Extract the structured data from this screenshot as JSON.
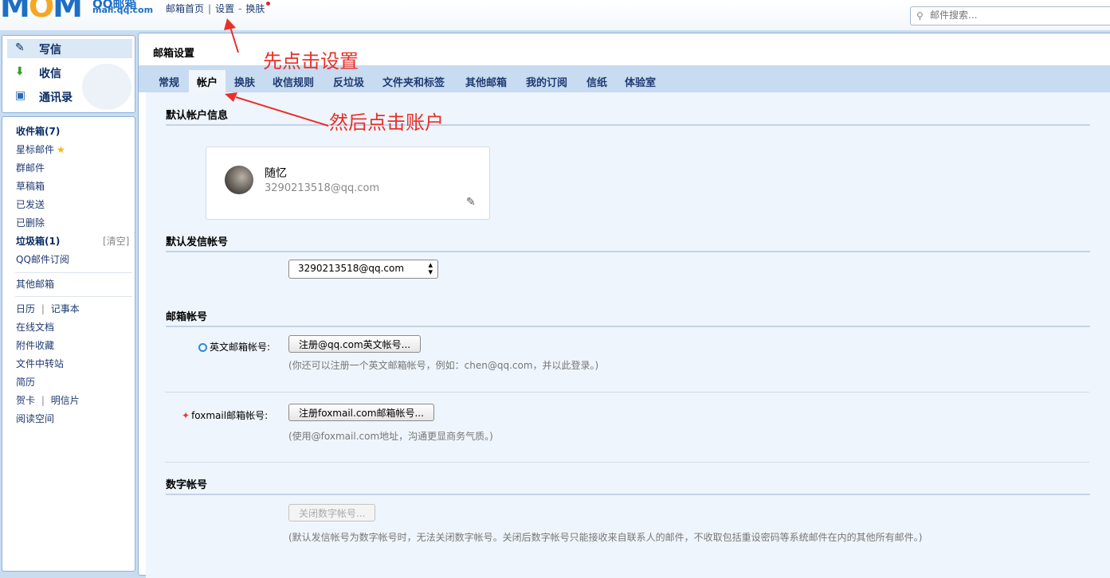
{
  "header": {
    "logo_mark": "M",
    "logo_mark_o": "O",
    "logo_mark_m2": "M",
    "logo_text": "QQ邮箱",
    "logo_url": "mail.qq.com",
    "links": [
      "邮箱首页",
      "设置",
      "换肤"
    ],
    "link_seps": [
      "|",
      "-"
    ],
    "search_placeholder": "邮件搜索...",
    "search_icon": "search-icon"
  },
  "sidebar": {
    "top_items": [
      {
        "label": "写信",
        "icon": "pen-paper-icon"
      },
      {
        "label": "收信",
        "icon": "download-tray-icon"
      },
      {
        "label": "通讯录",
        "icon": "contact-card-icon"
      }
    ],
    "folders": {
      "inbox": "收件箱(7)",
      "starred": "星标邮件",
      "group": "群邮件",
      "drafts": "草稿箱",
      "sent": "已发送",
      "deleted": "已删除",
      "spam": "垃圾箱(1)",
      "spam_clear": "[清空]",
      "subscriptions": "QQ邮件订阅",
      "other_mailboxes": "其他邮箱",
      "calendar": "日历",
      "notes": "记事本",
      "online_docs": "在线文档",
      "attachments": "附件收藏",
      "file_transfer": "文件中转站",
      "resume": "简历",
      "greeting_card": "贺卡",
      "postcard": "明信片",
      "reading_space": "阅读空间",
      "sep": "|"
    }
  },
  "main": {
    "title": "邮箱设置",
    "tabs": [
      "常规",
      "帐户",
      "换肤",
      "收信规则",
      "反垃圾",
      "文件夹和标签",
      "其他邮箱",
      "我的订阅",
      "信纸",
      "体验室"
    ],
    "active_tab": "帐户",
    "sections": {
      "default_account_info": "默认帐户信息",
      "default_sender": "默认发信帐号",
      "mailbox_accounts": "邮箱帐号",
      "digital_account": "数字帐号"
    },
    "profile": {
      "name": "随忆",
      "email": "3290213518@qq.com"
    },
    "sender_select_value": "3290213518@qq.com",
    "english_account": {
      "label": "英文邮箱帐号:",
      "button": "注册@qq.com英文帐号...",
      "hint": "(你还可以注册一个英文邮箱帐号，例如：chen@qq.com，并以此登录。)"
    },
    "foxmail_account": {
      "label": "foxmail邮箱帐号:",
      "button": "注册foxmail.com邮箱帐号...",
      "hint": "(使用@foxmail.com地址，沟通更显商务气质。)"
    },
    "digital": {
      "button": "关闭数字帐号...",
      "hint": "(默认发信帐号为数字帐号时，无法关闭数字帐号。关闭后数字帐号只能接收来自联系人的邮件，不收取包括重设密码等系统邮件在内的其他所有邮件。)"
    }
  },
  "annotations": {
    "step1": "先点击设置",
    "step2": "然后点击账户",
    "color": "#e8302a"
  }
}
